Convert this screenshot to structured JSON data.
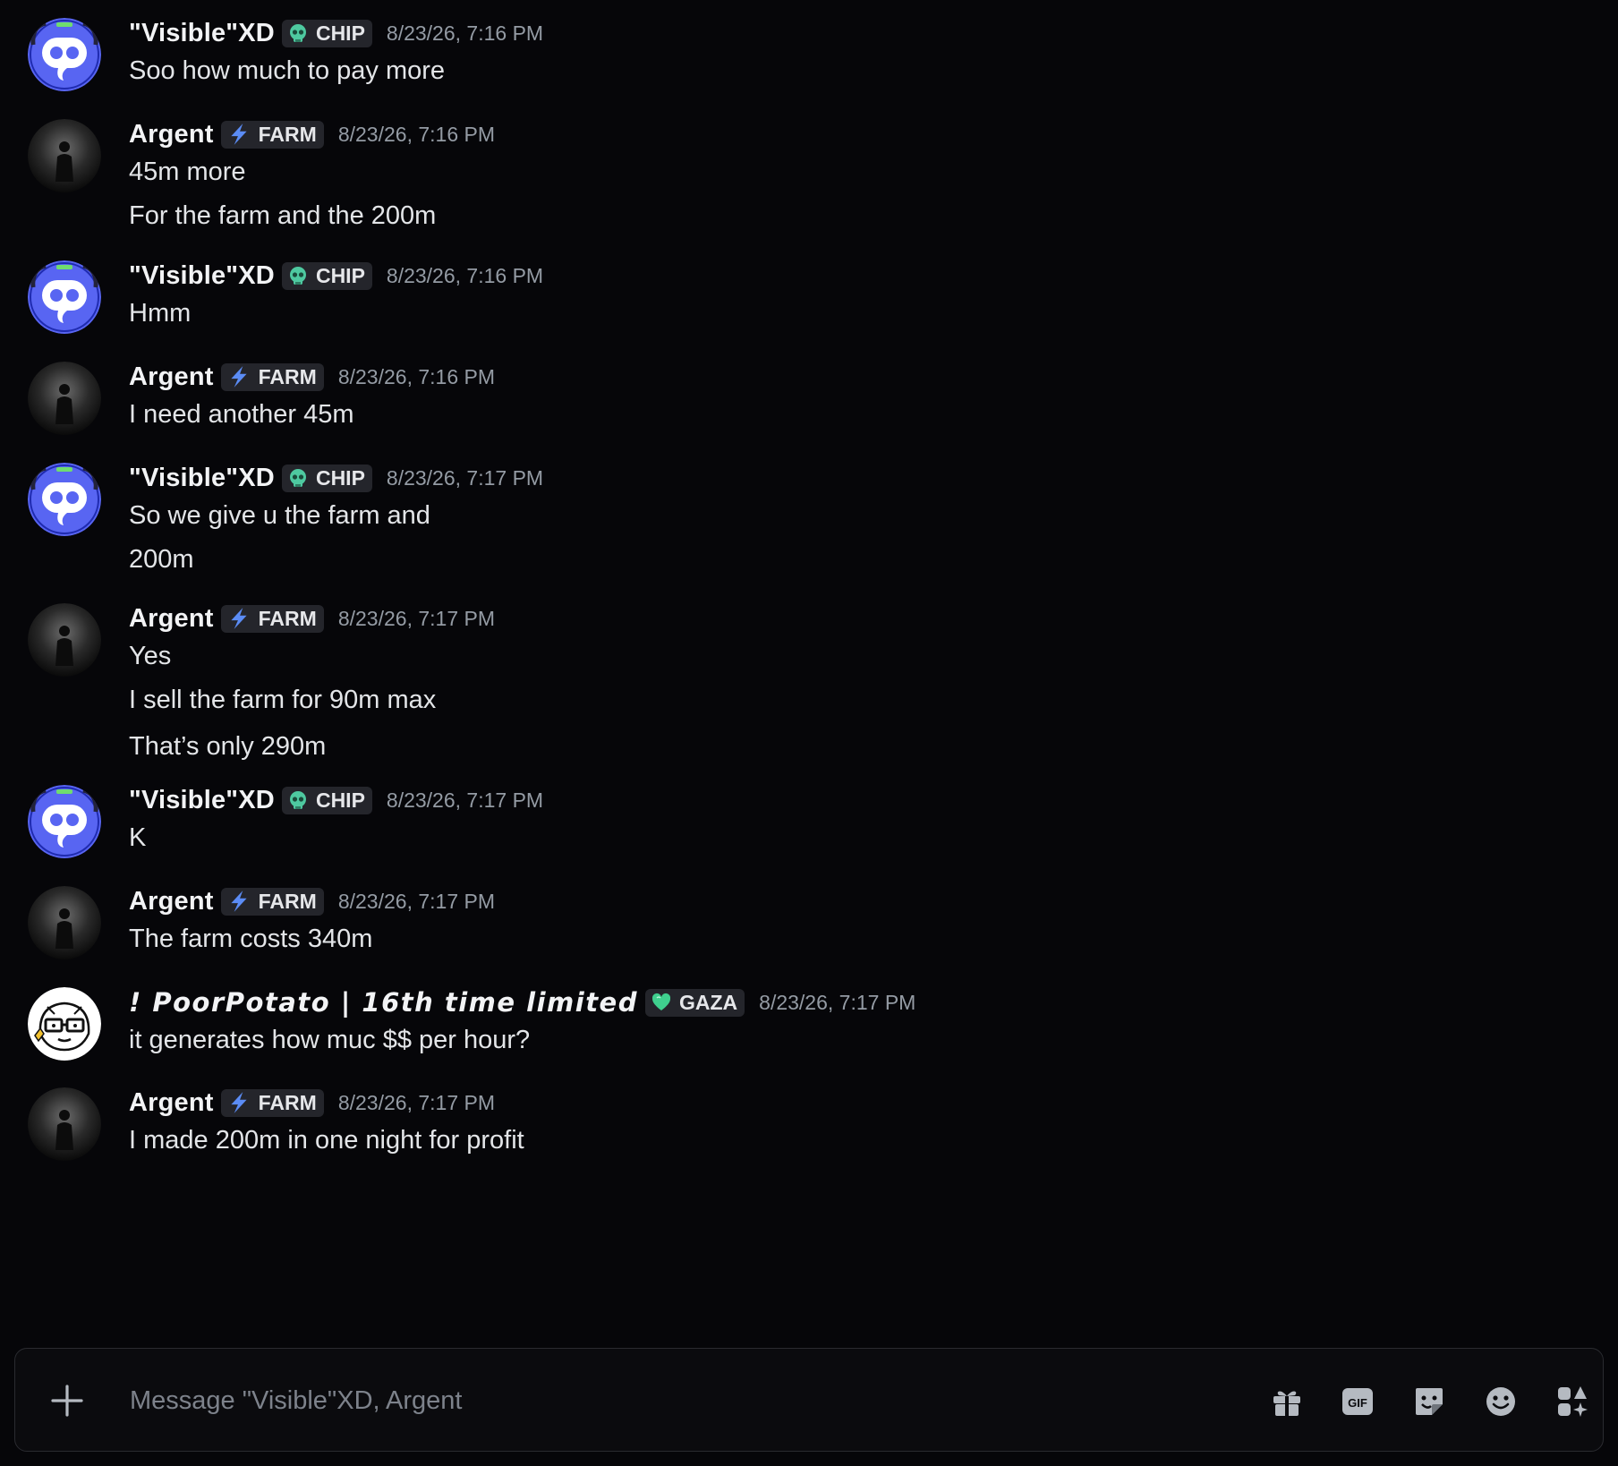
{
  "messages": [
    {
      "user": "\"Visible\"XD",
      "avatar": "discord-blue-avatar",
      "tag": "CHIP",
      "tag_icon": "skull-icon",
      "time": "8/23/26, 7:16 PM",
      "lines": [
        "Soo how much to pay more"
      ]
    },
    {
      "user": "Argent",
      "avatar": "dark-figure-avatar",
      "tag": "FARM",
      "tag_icon": "lightning-icon",
      "time": "8/23/26, 7:16 PM",
      "lines": [
        "45m more",
        "For the farm and the 200m"
      ]
    },
    {
      "user": "\"Visible\"XD",
      "avatar": "discord-blue-avatar",
      "tag": "CHIP",
      "tag_icon": "skull-icon",
      "time": "8/23/26, 7:16 PM",
      "lines": [
        "Hmm"
      ]
    },
    {
      "user": "Argent",
      "avatar": "dark-figure-avatar",
      "tag": "FARM",
      "tag_icon": "lightning-icon",
      "time": "8/23/26, 7:16 PM",
      "lines": [
        "I need another 45m"
      ]
    },
    {
      "user": "\"Visible\"XD",
      "avatar": "discord-blue-avatar",
      "tag": "CHIP",
      "tag_icon": "skull-icon",
      "time": "8/23/26, 7:17 PM",
      "lines": [
        "So we give u the farm and",
        "200m"
      ]
    },
    {
      "user": "Argent",
      "avatar": "dark-figure-avatar",
      "tag": "FARM",
      "tag_icon": "lightning-icon",
      "time": "8/23/26, 7:17 PM",
      "lines": [
        "Yes",
        "I sell the farm for 90m max",
        "That’s only 290m"
      ]
    },
    {
      "user": "\"Visible\"XD",
      "avatar": "discord-blue-avatar",
      "tag": "CHIP",
      "tag_icon": "skull-icon",
      "time": "8/23/26, 7:17 PM",
      "lines": [
        "K"
      ]
    },
    {
      "user": "Argent",
      "avatar": "dark-figure-avatar",
      "tag": "FARM",
      "tag_icon": "lightning-icon",
      "time": "8/23/26, 7:17 PM",
      "lines": [
        "The farm costs 340m"
      ]
    },
    {
      "user": "! PoorPotato | 16th time limited",
      "avatar": "cartoon-glasses-avatar",
      "tag": "GAZA",
      "tag_icon": "green-heart-icon",
      "time": "8/23/26, 7:17 PM",
      "lines": [
        "it generates how muc $$ per hour?"
      ]
    },
    {
      "user": "Argent",
      "avatar": "dark-figure-avatar",
      "tag": "FARM",
      "tag_icon": "lightning-icon",
      "time": "8/23/26, 7:17 PM",
      "lines": [
        "I made 200m in one night for profit"
      ]
    }
  ],
  "composer": {
    "placeholder": "Message \"Visible\"XD, Argent",
    "gif_label": "GIF",
    "icons": [
      "plus-icon",
      "gift-icon",
      "gif-icon",
      "sticker-icon",
      "emoji-icon",
      "apps-icon"
    ]
  },
  "colors": {
    "background": "#060609",
    "blurple": "#5865f2",
    "tag_bg": "#24252b",
    "timestamp": "#949ba4",
    "lightning": "#5b8cf5",
    "skull": "#4ec9a0",
    "heart": "#3fcf8e"
  }
}
